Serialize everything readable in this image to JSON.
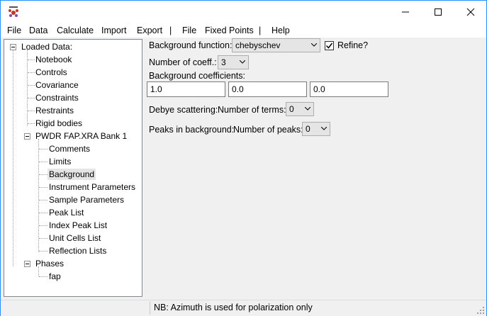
{
  "window": {
    "icon_text": "GSAS-II"
  },
  "menu": [
    "Help",
    "File",
    "Data",
    "Calculate",
    "Import",
    "Export",
    "|",
    "File",
    "Fixed Points",
    "|",
    "Help"
  ],
  "tree": {
    "root": "Loaded Data:",
    "items": [
      "Notebook",
      "Controls",
      "Covariance",
      "Constraints",
      "Restraints",
      "Rigid bodies"
    ],
    "histogram": "PWDR FAP.XRA Bank 1",
    "hist_children": [
      "Comments",
      "Limits",
      "Background",
      "Instrument Parameters",
      "Sample Parameters",
      "Peak List",
      "Index Peak List",
      "Unit Cells List",
      "Reflection Lists"
    ],
    "phases": "Phases",
    "phase_children": [
      "fap"
    ],
    "selected": "Background"
  },
  "background": {
    "function_label": "Background function:",
    "function_value": "chebyschev",
    "refine_label": "Refine?",
    "refine_checked": true,
    "ncoeff_label": "Number of coeff.:",
    "ncoeff_value": "3",
    "coeffs_label": "Background coefficients:",
    "coeffs": [
      "1.0",
      "0.0",
      "0.0"
    ],
    "debye_label": "Debye scattering:",
    "debye_terms_label": "Number of terms:",
    "debye_terms_value": "0",
    "peaks_label": "Peaks in background:",
    "peaks_num_label": "Number of peaks:",
    "peaks_num_value": "0"
  },
  "status": {
    "text": "NB: Azimuth is used for polarization only"
  }
}
